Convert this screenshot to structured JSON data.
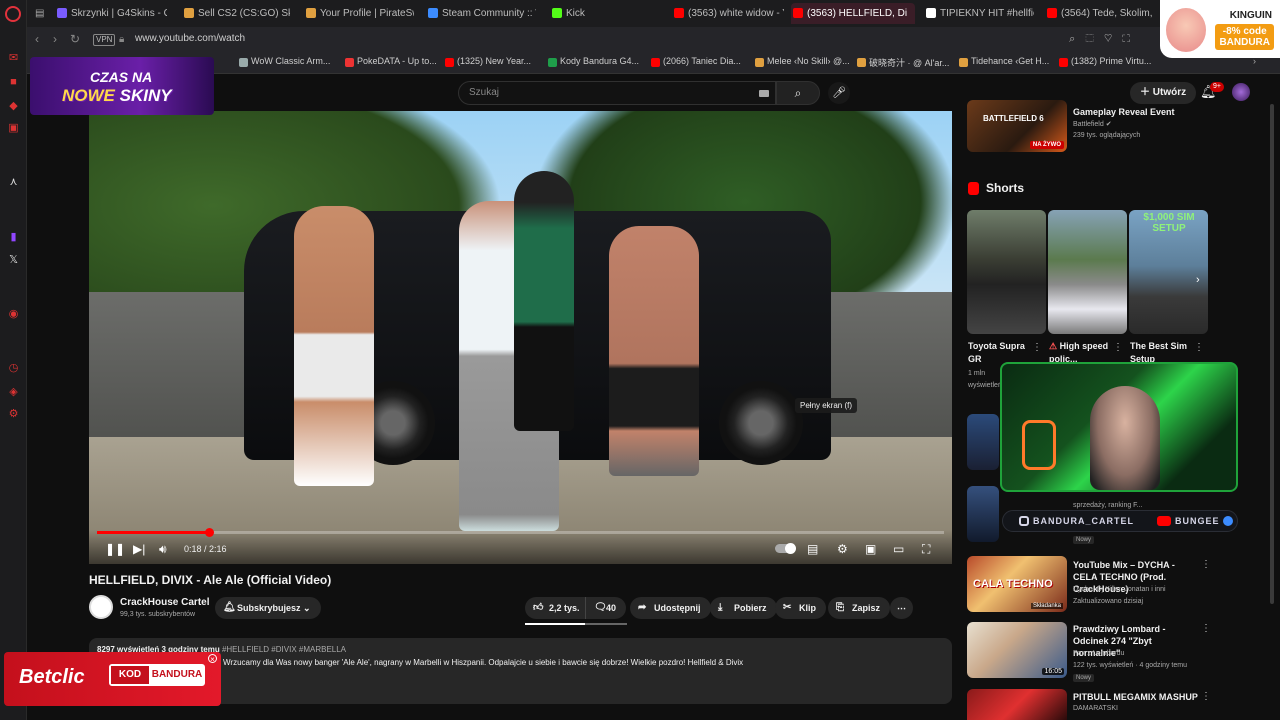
{
  "browser": {
    "tabs": [
      {
        "label": "Skrzynki | G4Skins - Otw",
        "color": "#7a5cff"
      },
      {
        "label": "Sell CS2 (CS:GO) Skins",
        "color": "#e0a040"
      },
      {
        "label": "Your Profile | PirateSwap",
        "color": "#e0a040"
      },
      {
        "label": "Steam Community :: Wh",
        "color": "#3c8cff"
      },
      {
        "label": "Kick",
        "color": "#53fc18"
      },
      {
        "label": "(3563) white widow - Yo",
        "color": "#ff0000"
      },
      {
        "label": "(3563) HELLFIELD, Di",
        "color": "#ff0000"
      },
      {
        "label": "TIPIEKNY HIT #hellfie",
        "color": "#ffffff"
      },
      {
        "label": "(3564) Tede, Skolim, Sto",
        "color": "#ff0000"
      }
    ],
    "vpn_label": "VPN",
    "url": "www.youtube.com/watch",
    "bookmarks": [
      {
        "label": "WoW Classic Arm...",
        "color": "#9aa"
      },
      {
        "label": "PokeDATA - Up to...",
        "color": "#e33"
      },
      {
        "label": "(1325) New Year...",
        "color": "#f00"
      },
      {
        "label": "Kody Bandura G4...",
        "color": "#1f9e4a"
      },
      {
        "label": "(2066) Taniec Dia...",
        "color": "#f00"
      },
      {
        "label": "Melee ‹No Skill› @...",
        "color": "#e0a040"
      },
      {
        "label": "破晓奇汁 · @ Al'ar...",
        "color": "#e0a040"
      },
      {
        "label": "Tidehance ‹Get H...",
        "color": "#e0a040"
      },
      {
        "label": "(1382) Prime Virtu...",
        "color": "#f00"
      }
    ]
  },
  "overlays": {
    "promo_line1": "CZAS NA",
    "promo_line2a": "NOWE",
    "promo_line2b": "SKINY",
    "kinguin_name": "KINGUIN",
    "kinguin_code_line1": "-8% code",
    "kinguin_code_line2": "BANDURA",
    "betclic_logo": "Betclic",
    "betclic_code_label": "KOD",
    "betclic_code_value": "BANDURA",
    "instagram_handle": "BANDURA_CARTEL",
    "youtube_handle": "BUNGEE"
  },
  "youtube": {
    "search_placeholder": "Szukaj",
    "create_label": "Utwórz",
    "notif_count": "9+",
    "player": {
      "current_time": "0:18",
      "duration": "2:16",
      "time_display": "0:18 / 2:16",
      "progress": 0.132,
      "tooltip": "Pełny ekran (f)"
    },
    "video": {
      "title": "HELLFIELD, DIVIX - Ale Ale (Official Video)",
      "channel": "CrackHouse Cartel",
      "subscribers": "99,3 tys. subskrybentów",
      "subscribe_label": "Subskrybujesz",
      "likes": "2,2 tys.",
      "dislikes": "40",
      "share": "Udostępnij",
      "download": "Pobierz",
      "clip": "Klip",
      "save": "Zapisz",
      "meta": "8297 wyświetleń  3 godziny temu",
      "tags": "#HELLFIELD #DIVIX #MARBELLA",
      "description": "Wrzucamy dla Was nowy banger 'Ale Ale', nagrany w Marbelli w Hiszpanii. Odpalajcie u siebie i bawcie się dobrze! Wielkie pozdro! Hellfield & Divix"
    },
    "recommended_top": {
      "title": "Gameplay Reveal Event",
      "channel": "Battlefield",
      "meta": "239 tys. oglądających",
      "badge": "NA ŻYWO",
      "thumb_text": "BATTLEFIELD 6"
    },
    "shorts_heading": "Shorts",
    "shorts": [
      {
        "title": "Toyota Supra GR",
        "meta1": "1 mln",
        "meta2": "wyświetleń"
      },
      {
        "title": "High speed polic...",
        "meta1": "",
        "meta2": ""
      },
      {
        "title": "The Best Sim Setup",
        "meta1": "",
        "meta2": "",
        "thumb_text": "$1,000 SIM SETUP"
      }
    ],
    "recommended": [
      {
        "title": "",
        "channel": "",
        "meta": "sprzedaży, ranking F...",
        "badge": "Nowy",
        "duration": ""
      },
      {
        "title": "YouTube Mix – DYCHA - CELA TECHNO (Prod. CrackHouse)",
        "channel": "Dycha, Dj Killer, Jonatan i inni",
        "meta": "Zaktualizowano dzisiaj",
        "badge": "",
        "duration": ""
      },
      {
        "title": "Prawdziwy Lombard - Odcinek 274 \"Zbyt normalnie\"",
        "channel": "Pan z Lombardu",
        "meta": "122 tys. wyświetleń · 4 godziny temu",
        "badge": "Nowy",
        "duration": "16:05",
        "thumb_text": "Składanka"
      },
      {
        "title": "PITBULL MEGAMIX MASHUP",
        "channel": "DAMARATSKI",
        "meta": "",
        "badge": "",
        "duration": ""
      }
    ],
    "mix_thumb_text": "CALA TECHNO"
  },
  "icons": {
    "play_pause": "pause-icon",
    "next": "next-icon",
    "volume": "volume-icon",
    "subtitles": "subtitles-icon",
    "settings": "gear-icon",
    "miniplayer": "miniplayer-icon",
    "theater": "theater-icon",
    "fullscreen": "fullscreen-icon"
  }
}
